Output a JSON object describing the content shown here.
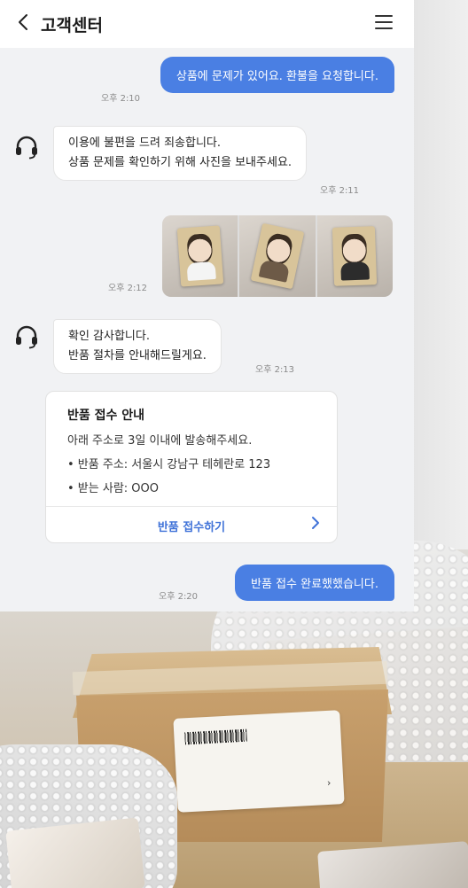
{
  "header": {
    "back_icon": "chevron-left-icon",
    "title": "고객센터",
    "menu_icon": "hamburger-menu-icon"
  },
  "messages": [
    {
      "from": "user",
      "text": "상품에 문제가 있어요. 환불을 요청합니다.",
      "time": "오후 2:10"
    },
    {
      "from": "agent",
      "lines": [
        "이용에 불편을 드려 죄송합니다.",
        "상품 문제를 확인하기 위해 사진을 보내주세요."
      ],
      "time": "오후 2:11"
    },
    {
      "from": "user",
      "type": "photos",
      "count": 3,
      "time": "오후 2:12"
    },
    {
      "from": "agent",
      "lines": [
        "확인 감사합니다.",
        "반품 절차를 안내해드릴게요."
      ],
      "time": "오후 2:13"
    },
    {
      "from": "user",
      "text": "반품 접수 완료했했습니다.",
      "time": "오후 2:20"
    }
  ],
  "return_notice": {
    "title": "반품 접수 안내",
    "lines": [
      "아래 주소로 3일 이내에 발송해주세요.",
      "• 반품 주소: 서울시 강남구 테헤란로 123",
      "• 받는 사람: OOO"
    ],
    "action_label": "반품 접수하기",
    "action_icon": "chevron-right-icon"
  },
  "colors": {
    "user_bubble": "#4a7fe3",
    "accent_link": "#3f72d8",
    "panel_bg": "#f1f2f4"
  }
}
